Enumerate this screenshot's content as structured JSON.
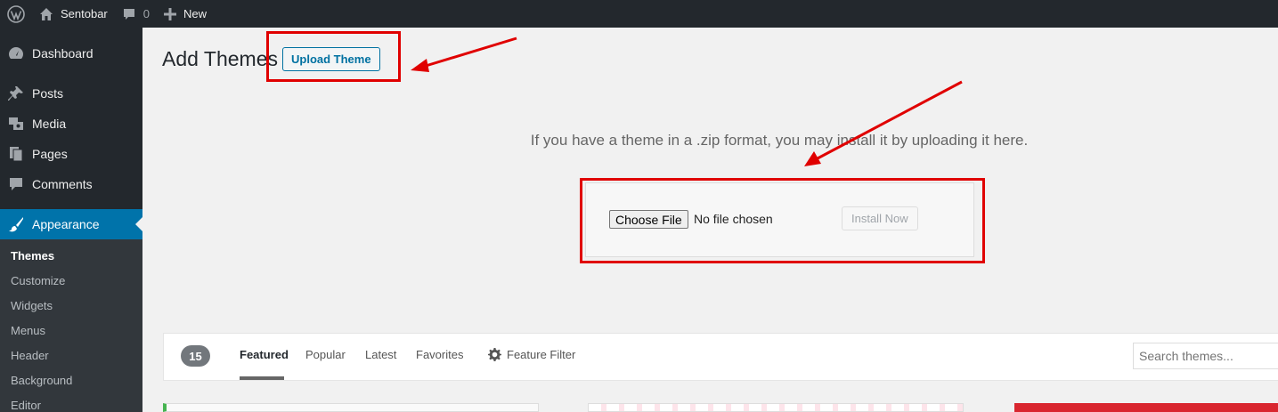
{
  "adminbar": {
    "site_name": "Sentobar",
    "comments_count": "0",
    "new_label": "New"
  },
  "sidebar": {
    "items": [
      {
        "label": "Dashboard"
      },
      {
        "label": "Posts"
      },
      {
        "label": "Media"
      },
      {
        "label": "Pages"
      },
      {
        "label": "Comments"
      },
      {
        "label": "Appearance"
      }
    ],
    "submenu": [
      {
        "label": "Themes"
      },
      {
        "label": "Customize"
      },
      {
        "label": "Widgets"
      },
      {
        "label": "Menus"
      },
      {
        "label": "Header"
      },
      {
        "label": "Background"
      },
      {
        "label": "Editor"
      }
    ]
  },
  "main": {
    "title": "Add Themes",
    "upload_button": "Upload Theme",
    "upload_help": "If you have a theme in a .zip format, you may install it by uploading it here.",
    "choose_file": "Choose File",
    "no_file": "No file chosen",
    "install_button": "Install Now"
  },
  "filter": {
    "count": "15",
    "tabs": [
      {
        "label": "Featured"
      },
      {
        "label": "Popular"
      },
      {
        "label": "Latest"
      },
      {
        "label": "Favorites"
      }
    ],
    "feature_filter": "Feature Filter",
    "search_placeholder": "Search themes..."
  },
  "colors": {
    "adminbar_bg": "#23282d",
    "active_menu": "#0073aa",
    "annotation_red": "#e00000"
  }
}
